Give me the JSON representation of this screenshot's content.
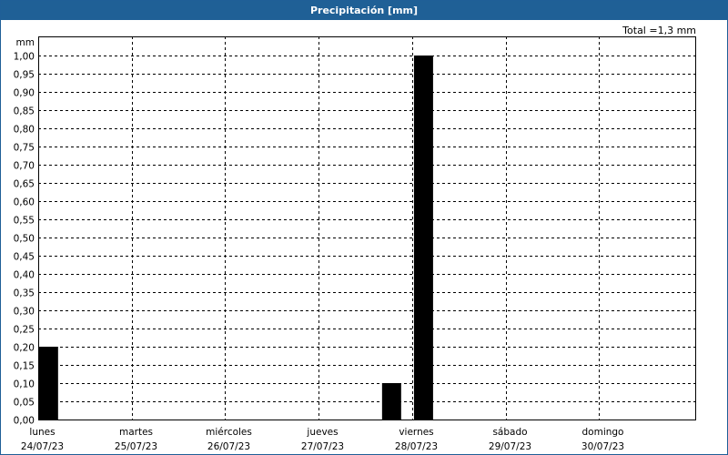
{
  "window": {
    "title": "Precipitación [mm]"
  },
  "chart_data": {
    "type": "bar",
    "title": "Precipitación [mm]",
    "ylabel": "mm",
    "total_label": "Total =1,3 mm",
    "ylim": [
      0,
      1.0
    ],
    "ytick_step": 0.05,
    "yticks": [
      "0,00",
      "0,05",
      "0,10",
      "0,15",
      "0,20",
      "0,25",
      "0,30",
      "0,35",
      "0,40",
      "0,45",
      "0,50",
      "0,55",
      "0,60",
      "0,65",
      "0,70",
      "0,75",
      "0,80",
      "0,85",
      "0,90",
      "0,95",
      "1,00"
    ],
    "categories": [
      {
        "day": "lunes",
        "date": "24/07/23"
      },
      {
        "day": "martes",
        "date": "25/07/23"
      },
      {
        "day": "miércoles",
        "date": "26/07/23"
      },
      {
        "day": "jueves",
        "date": "27/07/23"
      },
      {
        "day": "viernes",
        "date": "28/07/23"
      },
      {
        "day": "sábado",
        "date": "29/07/23"
      },
      {
        "day": "domingo",
        "date": "30/07/23"
      }
    ],
    "x_unit": "hours since start of lunes",
    "bars": [
      {
        "start_hour": 0.2,
        "duration_hours": 4.9,
        "value": 0.2
      },
      {
        "start_hour": 88.3,
        "duration_hours": 4.9,
        "value": 0.1
      },
      {
        "start_hour": 96.5,
        "duration_hours": 4.9,
        "value": 1.0
      }
    ],
    "grid": true,
    "bar_color": "#000000",
    "title_bar_color": "#1f6096"
  }
}
